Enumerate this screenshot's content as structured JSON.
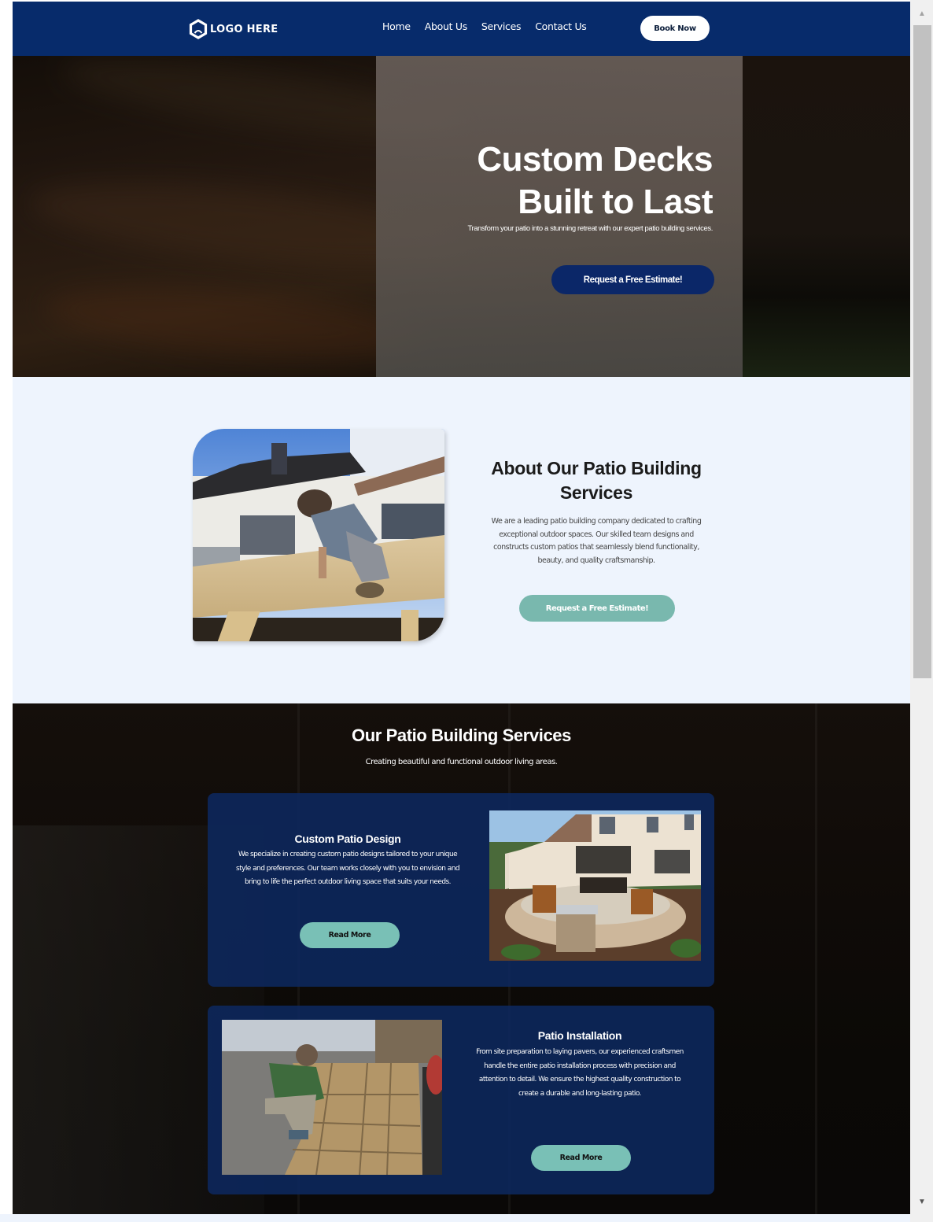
{
  "nav": {
    "logo_text": "LOGO HERE",
    "links": [
      {
        "label": "Home"
      },
      {
        "label": "About Us"
      },
      {
        "label": "Services"
      },
      {
        "label": "Contact Us"
      }
    ],
    "cta_label": "Book Now"
  },
  "hero": {
    "title_line1": "Custom Decks",
    "title_line2": "Built to Last",
    "subtitle": "Transform your patio into a stunning retreat with our expert patio building services.",
    "cta_label": "Request a Free Estimate!"
  },
  "about": {
    "title": "About Our Patio Building Services",
    "body": "We are a leading patio building company dedicated to crafting exceptional outdoor spaces. Our skilled team designs and constructs custom patios that seamlessly blend functionality, beauty, and quality craftsmanship.",
    "cta_label": "Request a Free Estimate!",
    "image_alt": "worker building wooden deck"
  },
  "services": {
    "title": "Our Patio Building Services",
    "subtitle": "Creating beautiful and functional outdoor living areas.",
    "cards": [
      {
        "title": "Custom Patio Design",
        "body": "We specialize in creating custom patio designs tailored to your unique style and preferences. Our team works closely with you to envision and bring to life the perfect outdoor living space that suits your needs.",
        "button_label": "Read More",
        "image_alt": "circular stone patio with fire pit"
      },
      {
        "title": "Patio Installation",
        "body": "From site preparation to laying pavers, our experienced craftsmen handle the entire patio installation process with precision and attention to detail. We ensure the highest quality construction to create a durable and long-lasting patio.",
        "button_label": "Read More",
        "image_alt": "worker laying stone pavers"
      }
    ]
  },
  "colors": {
    "navy": "#072b6b",
    "teal": "#79b8ae",
    "light_bg": "#eef4fd",
    "card_bg": "#0c285f"
  },
  "scrollbar": {
    "up_icon": "▲",
    "down_icon": "▼"
  }
}
